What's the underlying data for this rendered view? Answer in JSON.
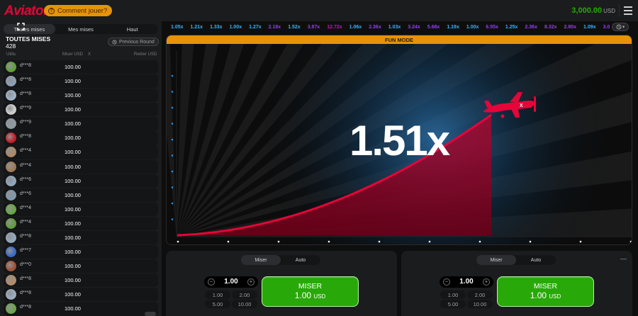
{
  "header": {
    "logo": "Aviator",
    "how_to_play": "Comment jouer?",
    "balance": "3,000.00",
    "currency": "USD"
  },
  "left_panel": {
    "tabs": [
      "Toutes mises",
      "Mes mises",
      "Haut"
    ],
    "title": "TOUTES MISES",
    "count": "428",
    "previous_round": "Previous Round",
    "columns": {
      "user": "Utilis.",
      "bet": "Miser USD",
      "x": "X",
      "cashout": "Retirer USD"
    },
    "rows": [
      {
        "user": "d***8",
        "bet": "100.00",
        "avatar_color": "#5fa03a"
      },
      {
        "user": "d***8",
        "bet": "100.00",
        "avatar_color": "#8aa0b8"
      },
      {
        "user": "d***8",
        "bet": "100.00",
        "avatar_color": "#9db3c8"
      },
      {
        "user": "d***9",
        "bet": "100.00",
        "avatar_color": "#cfcfcf"
      },
      {
        "user": "d***9",
        "bet": "100.00",
        "avatar_color": "#8e99a3"
      },
      {
        "user": "d***8",
        "bet": "100.00",
        "avatar_color": "#c0202a"
      },
      {
        "user": "d***4",
        "bet": "100.00",
        "avatar_color": "#b08866"
      },
      {
        "user": "d***4",
        "bet": "100.00",
        "avatar_color": "#a07a58"
      },
      {
        "user": "d***6",
        "bet": "100.00",
        "avatar_color": "#8fa7bb"
      },
      {
        "user": "d***6",
        "bet": "100.00",
        "avatar_color": "#7f98ad"
      },
      {
        "user": "d***4",
        "bet": "100.00",
        "avatar_color": "#66a843"
      },
      {
        "user": "d***4",
        "bet": "100.00",
        "avatar_color": "#5f9e3e"
      },
      {
        "user": "d***8",
        "bet": "100.00",
        "avatar_color": "#93a8bc"
      },
      {
        "user": "d***7",
        "bet": "100.00",
        "avatar_color": "#3a6cc4"
      },
      {
        "user": "d***0",
        "bet": "100.00",
        "avatar_color": "#a0523a"
      },
      {
        "user": "d***8",
        "bet": "100.00",
        "avatar_color": "#b48a68"
      },
      {
        "user": "d***8",
        "bet": "100.00",
        "avatar_color": "#9aacbf"
      },
      {
        "user": "d***8",
        "bet": "100.00",
        "avatar_color": "#6aa64a"
      }
    ]
  },
  "history": [
    {
      "v": "1.05x",
      "c": "#34b4ff"
    },
    {
      "v": "1.21x",
      "c": "#34b4ff"
    },
    {
      "v": "1.33x",
      "c": "#34b4ff"
    },
    {
      "v": "1.00x",
      "c": "#34b4ff"
    },
    {
      "v": "1.27x",
      "c": "#34b4ff"
    },
    {
      "v": "2.18x",
      "c": "#913ef8"
    },
    {
      "v": "1.52x",
      "c": "#34b4ff"
    },
    {
      "v": "3.87x",
      "c": "#913ef8"
    },
    {
      "v": "12.72x",
      "c": "#c017b4"
    },
    {
      "v": "1.06x",
      "c": "#34b4ff"
    },
    {
      "v": "2.36x",
      "c": "#913ef8"
    },
    {
      "v": "1.03x",
      "c": "#34b4ff"
    },
    {
      "v": "3.24x",
      "c": "#913ef8"
    },
    {
      "v": "5.68x",
      "c": "#913ef8"
    },
    {
      "v": "1.19x",
      "c": "#34b4ff"
    },
    {
      "v": "1.00x",
      "c": "#34b4ff"
    },
    {
      "v": "6.55x",
      "c": "#913ef8"
    },
    {
      "v": "1.25x",
      "c": "#34b4ff"
    },
    {
      "v": "2.36x",
      "c": "#913ef8"
    },
    {
      "v": "8.32x",
      "c": "#913ef8"
    },
    {
      "v": "2.80x",
      "c": "#913ef8"
    },
    {
      "v": "1.09x",
      "c": "#34b4ff"
    },
    {
      "v": "3.0",
      "c": "#913ef8"
    }
  ],
  "game": {
    "mode": "FUN MODE",
    "multiplier": "1.51x",
    "accent": "#e50539"
  },
  "bet_panels": [
    {
      "tab_bet": "Miser",
      "tab_auto": "Auto",
      "stake": "1.00",
      "quick": [
        "1.00",
        "2.00",
        "5.00",
        "10.00"
      ],
      "button_label": "MISER",
      "button_amount": "1.00",
      "button_currency": "USD"
    },
    {
      "tab_bet": "Miser",
      "tab_auto": "Auto",
      "stake": "1.00",
      "quick": [
        "1.00",
        "2.00",
        "5.00",
        "10.00"
      ],
      "button_label": "MISER",
      "button_amount": "1.00",
      "button_currency": "USD",
      "more": "—"
    }
  ]
}
